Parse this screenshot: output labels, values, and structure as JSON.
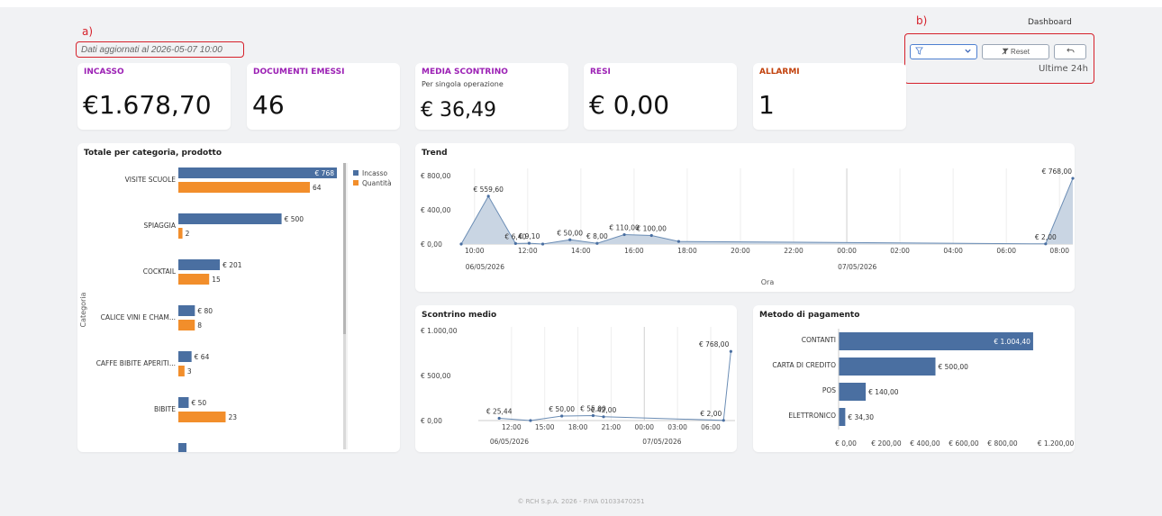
{
  "header": {
    "annotation_a": "a)",
    "annotation_b": "b)",
    "dashboard_label": "Dashboard",
    "updated_text": "Dati aggiornati al 2026-05-07 10:00"
  },
  "filters": {
    "filter_icon": "funnel-icon",
    "dropdown_icon": "chevron-down-icon",
    "reset_label": "Reset",
    "reset_icon": "filter-off-icon",
    "undo_icon": "undo-icon",
    "period_label": "Ultime 24h"
  },
  "kpis": {
    "incasso": {
      "title": "INCASSO",
      "value": "€1.678,70"
    },
    "documenti": {
      "title": "DOCUMENTI EMESSI",
      "value": "46"
    },
    "media": {
      "title": "MEDIA SCONTRINO",
      "subtitle": "Per singola operazione",
      "value": "€ 36,49"
    },
    "resi": {
      "title": "RESI",
      "value": "€ 0,00"
    },
    "allarmi": {
      "title": "ALLARMI",
      "value": "1"
    }
  },
  "colors": {
    "purple": "#9b1fb4",
    "orange_dark": "#c2410c",
    "blue": "#4a6fa1",
    "orange": "#f28e2b",
    "area": "#c9d5e3",
    "red": "#d6202a"
  },
  "chart_data": [
    {
      "id": "categoria",
      "type": "bar",
      "title": "Totale per categoria, prodotto",
      "ylabel": "Categoria",
      "orientation": "horizontal",
      "categories": [
        "VISITE SCUOLE",
        "SPIAGGIA",
        "COCKTAIL",
        "CALICE VINI E CHAM...",
        "CAFFE BIBITE APERITI...",
        "BIBITE"
      ],
      "series": [
        {
          "name": "Incasso",
          "values": [
            768,
            500,
            201,
            80,
            64,
            50
          ],
          "labels": [
            "€ 768",
            "€ 500",
            "€ 201",
            "€ 80",
            "€ 64",
            "€ 50"
          ]
        },
        {
          "name": "Quantità",
          "values": [
            64,
            2,
            15,
            8,
            3,
            23
          ],
          "labels": [
            "64",
            "2",
            "15",
            "8",
            "3",
            "23"
          ]
        }
      ]
    },
    {
      "id": "trend",
      "type": "area",
      "title": "Trend",
      "xlabel": "Ora",
      "x_ticks": [
        "10:00",
        "12:00",
        "14:00",
        "16:00",
        "18:00",
        "20:00",
        "22:00",
        "00:00",
        "02:00",
        "04:00",
        "06:00",
        "08:00"
      ],
      "date_labels": [
        "06/05/2026",
        "07/05/2026"
      ],
      "y_ticks": [
        "€ 800,00",
        "€ 400,00",
        "€ 0,00"
      ],
      "ylim": [
        0,
        800
      ],
      "points": [
        {
          "x": 9.0,
          "y": 0,
          "label": ""
        },
        {
          "x": 11.0,
          "y": 559.6,
          "label": "€ 559,60"
        },
        {
          "x": 13.0,
          "y": 6.4,
          "label": "€ 6,40"
        },
        {
          "x": 14.0,
          "y": 9.1,
          "label": "€ 9,10"
        },
        {
          "x": 15.0,
          "y": 0,
          "label": ""
        },
        {
          "x": 17.0,
          "y": 50.0,
          "label": "€ 50,00"
        },
        {
          "x": 19.0,
          "y": 8.0,
          "label": "€ 8,00"
        },
        {
          "x": 21.0,
          "y": 110.0,
          "label": "€ 110,00"
        },
        {
          "x": 23.0,
          "y": 100.0,
          "label": "€ 100,00"
        },
        {
          "x": 25.0,
          "y": 30,
          "label": ""
        },
        {
          "x": 52.0,
          "y": 2.0,
          "label": "€ 2,00"
        },
        {
          "x": 54.0,
          "y": 768.0,
          "label": "€ 768,00"
        }
      ]
    },
    {
      "id": "scontrino",
      "type": "line",
      "title": "Scontrino medio",
      "x_ticks": [
        "12:00",
        "15:00",
        "18:00",
        "21:00",
        "00:00",
        "03:00",
        "06:00"
      ],
      "date_labels": [
        "06/05/2026",
        "07/05/2026"
      ],
      "y_ticks": [
        "€ 1.000,00",
        "€ 500,00",
        "€ 0,00"
      ],
      "ylim": [
        0,
        1000
      ],
      "points": [
        {
          "x": 10.0,
          "y": 25.44,
          "label": "€ 25,44"
        },
        {
          "x": 13.0,
          "y": 0,
          "label": ""
        },
        {
          "x": 16.0,
          "y": 50.0,
          "label": "€ 50,00"
        },
        {
          "x": 19.0,
          "y": 55.0,
          "label": "€ 55,00"
        },
        {
          "x": 20.0,
          "y": 42.0,
          "label": "€ 42,00"
        },
        {
          "x": 31.5,
          "y": 2.0,
          "label": "€ 2,00"
        },
        {
          "x": 32.2,
          "y": 768.0,
          "label": "€ 768,00"
        }
      ]
    },
    {
      "id": "pagamento",
      "type": "bar",
      "title": "Metodo di pagamento",
      "orientation": "horizontal",
      "categories": [
        "CONTANTI",
        "CARTA DI CREDITO",
        "POS",
        "ELETTRONICO"
      ],
      "values": [
        1004.4,
        500.0,
        140.0,
        34.3
      ],
      "labels": [
        "€ 1.004,40",
        "€ 500,00",
        "€ 140,00",
        "€ 34,30"
      ],
      "x_ticks": [
        "€ 0,00",
        "€ 200,00",
        "€ 400,00",
        "€ 600,00",
        "€ 800,00",
        "€ 1.200,00"
      ],
      "xlim": [
        0,
        1200
      ]
    }
  ],
  "footer": {
    "text": "© RCH S.p.A. 2026 - P.IVA 01033470251"
  }
}
